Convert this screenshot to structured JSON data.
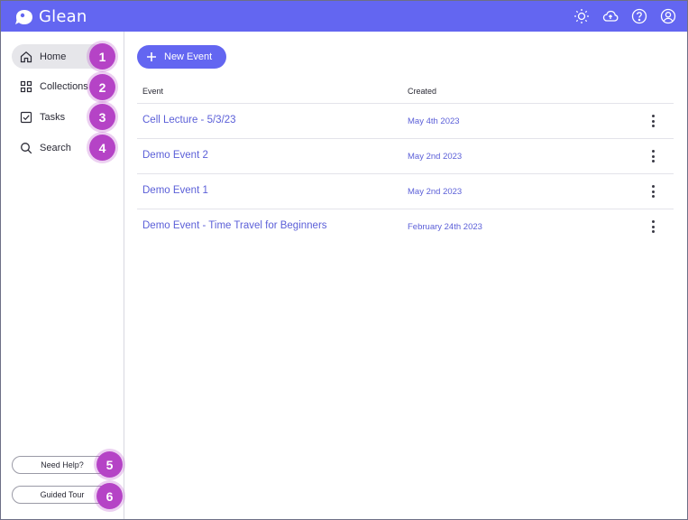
{
  "app": {
    "name": "Glean"
  },
  "colors": {
    "brand": "#6366f1",
    "badge": "#b543c6",
    "link": "#5b5fd8"
  },
  "topbar": {
    "icons": [
      "sun-icon",
      "cloud-icon",
      "help-icon",
      "user-icon"
    ]
  },
  "sidebar": {
    "items": [
      {
        "label": "Home",
        "icon": "home-icon",
        "badge": "1",
        "active": true
      },
      {
        "label": "Collections",
        "icon": "grid-icon",
        "badge": "2"
      },
      {
        "label": "Tasks",
        "icon": "checkbox-icon",
        "badge": "3"
      },
      {
        "label": "Search",
        "icon": "search-icon",
        "badge": "4"
      }
    ],
    "help_label": "Need Help?",
    "help_badge": "5",
    "tour_label": "Guided Tour",
    "tour_badge": "6"
  },
  "main": {
    "new_event_label": "New Event",
    "columns": {
      "event": "Event",
      "created": "Created"
    },
    "events": [
      {
        "name": "Cell Lecture - 5/3/23",
        "created": "May 4th 2023"
      },
      {
        "name": "Demo Event 2",
        "created": "May 2nd 2023"
      },
      {
        "name": "Demo Event 1",
        "created": "May 2nd 2023"
      },
      {
        "name": "Demo Event - Time Travel for Beginners",
        "created": "February 24th 2023"
      }
    ]
  }
}
